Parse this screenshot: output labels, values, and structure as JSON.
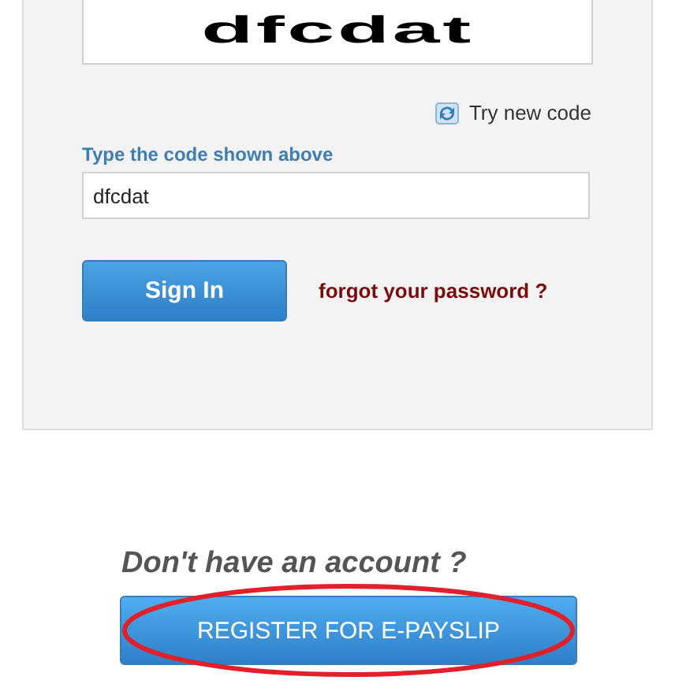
{
  "captcha": {
    "text": "dfcdat"
  },
  "refresh": {
    "label": "Try new code"
  },
  "code_field": {
    "label": "Type the code shown above",
    "value": "dfcdat"
  },
  "sign_in_button": {
    "label": "Sign In"
  },
  "forgot_link": {
    "label": "forgot your password ?"
  },
  "register": {
    "prompt": "Don't have an account ?",
    "button": "REGISTER FOR E-PAYSLIP",
    "circled": true
  }
}
